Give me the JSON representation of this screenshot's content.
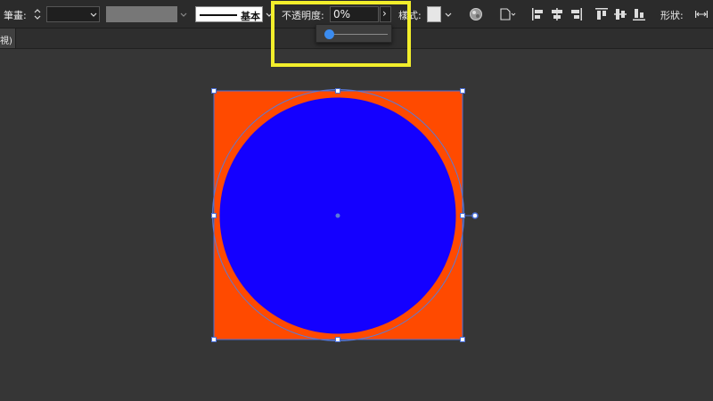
{
  "toolbar": {
    "stroke_label": "筆畫:",
    "stroke_weight_value": "",
    "brush_label": "基本",
    "opacity_label": "不透明度:",
    "opacity_value": "0%",
    "opacity_expand_glyph": "›",
    "style_label": "樣式:",
    "shape_label": "形狀:",
    "fill_swatch_color": "#777777",
    "style_swatch_color": "#e6e6e6",
    "icons": [
      "recolor-icon",
      "doc-setup-icon",
      "align-left-icon",
      "align-hcenter-icon",
      "align-right-icon",
      "align-top-icon",
      "align-vcenter-icon",
      "align-bottom-icon",
      "distribute-icon"
    ]
  },
  "opacity_slider": {
    "value_percent": 0
  },
  "tab_bar": {
    "tab_label": "視)"
  },
  "artwork": {
    "rectangle_color": "#ff4a00",
    "circle_color": "#1400ff",
    "selection_color": "#4a6fd8"
  },
  "highlight_color": "#f2ee2b"
}
